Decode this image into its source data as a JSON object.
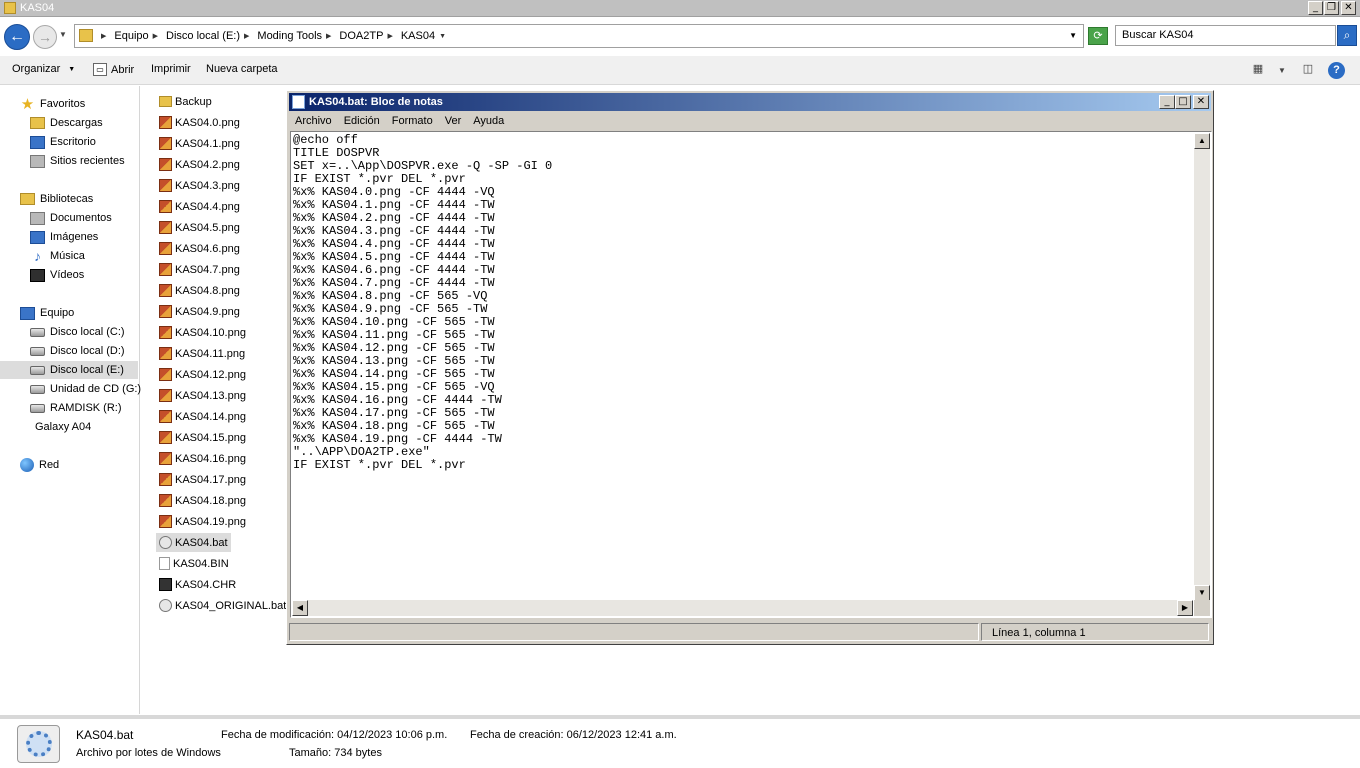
{
  "window": {
    "title": "KAS04"
  },
  "address": {
    "crumbs": [
      "Equipo",
      "Disco local (E:)",
      "Moding Tools",
      "DOA2TP",
      "KAS04"
    ],
    "search_placeholder": "Buscar KAS04"
  },
  "toolbar": {
    "organize": "Organizar",
    "open": "Abrir",
    "print": "Imprimir",
    "new_folder": "Nueva carpeta"
  },
  "nav": {
    "favorites": "Favoritos",
    "downloads": "Descargas",
    "desktop": "Escritorio",
    "recent": "Sitios recientes",
    "libraries": "Bibliotecas",
    "documents": "Documentos",
    "images": "Imágenes",
    "music": "Música",
    "videos": "Vídeos",
    "computer": "Equipo",
    "drive_c": "Disco local (C:)",
    "drive_d": "Disco local (D:)",
    "drive_e": "Disco local (E:)",
    "drive_g": "Unidad de CD (G:)",
    "ramdisk": "RAMDISK (R:)",
    "galaxy": "Galaxy A04",
    "network": "Red"
  },
  "files": [
    {
      "name": "Backup",
      "type": "folder"
    },
    {
      "name": "KAS04.0.png",
      "type": "png"
    },
    {
      "name": "KAS04.1.png",
      "type": "png"
    },
    {
      "name": "KAS04.2.png",
      "type": "png"
    },
    {
      "name": "KAS04.3.png",
      "type": "png"
    },
    {
      "name": "KAS04.4.png",
      "type": "png"
    },
    {
      "name": "KAS04.5.png",
      "type": "png"
    },
    {
      "name": "KAS04.6.png",
      "type": "png"
    },
    {
      "name": "KAS04.7.png",
      "type": "png"
    },
    {
      "name": "KAS04.8.png",
      "type": "png"
    },
    {
      "name": "KAS04.9.png",
      "type": "png"
    },
    {
      "name": "KAS04.10.png",
      "type": "png"
    },
    {
      "name": "KAS04.11.png",
      "type": "png"
    },
    {
      "name": "KAS04.12.png",
      "type": "png"
    },
    {
      "name": "KAS04.13.png",
      "type": "png"
    },
    {
      "name": "KAS04.14.png",
      "type": "png"
    },
    {
      "name": "KAS04.15.png",
      "type": "png"
    },
    {
      "name": "KAS04.16.png",
      "type": "png"
    },
    {
      "name": "KAS04.17.png",
      "type": "png"
    },
    {
      "name": "KAS04.18.png",
      "type": "png"
    },
    {
      "name": "KAS04.19.png",
      "type": "png"
    },
    {
      "name": "KAS04.bat",
      "type": "bat"
    },
    {
      "name": "KAS04.BIN",
      "type": "bin"
    },
    {
      "name": "KAS04.CHR",
      "type": "chr"
    },
    {
      "name": "KAS04_ORIGINAL.bat",
      "type": "bat"
    }
  ],
  "notepad": {
    "title": "KAS04.bat: Bloc de notas",
    "menu": [
      "Archivo",
      "Edición",
      "Formato",
      "Ver",
      "Ayuda"
    ],
    "content": "@echo off\nTITLE DOSPVR\nSET x=..\\App\\DOSPVR.exe -Q -SP -GI 0\nIF EXIST *.pvr DEL *.pvr\n%x% KAS04.0.png -CF 4444 -VQ\n%x% KAS04.1.png -CF 4444 -TW\n%x% KAS04.2.png -CF 4444 -TW\n%x% KAS04.3.png -CF 4444 -TW\n%x% KAS04.4.png -CF 4444 -TW\n%x% KAS04.5.png -CF 4444 -TW\n%x% KAS04.6.png -CF 4444 -TW\n%x% KAS04.7.png -CF 4444 -TW\n%x% KAS04.8.png -CF 565 -VQ\n%x% KAS04.9.png -CF 565 -TW\n%x% KAS04.10.png -CF 565 -TW\n%x% KAS04.11.png -CF 565 -TW\n%x% KAS04.12.png -CF 565 -TW\n%x% KAS04.13.png -CF 565 -TW\n%x% KAS04.14.png -CF 565 -TW\n%x% KAS04.15.png -CF 565 -VQ\n%x% KAS04.16.png -CF 4444 -TW\n%x% KAS04.17.png -CF 565 -TW\n%x% KAS04.18.png -CF 565 -TW\n%x% KAS04.19.png -CF 4444 -TW\n\"..\\APP\\DOA2TP.exe\"\nIF EXIST *.pvr DEL *.pvr",
    "status": "Línea 1, columna 1"
  },
  "details": {
    "name": "KAS04.bat",
    "type": "Archivo por lotes de Windows",
    "modified": "Fecha de modificación: 04/12/2023 10:06 p.m.",
    "created": "Fecha de creación: 06/12/2023 12:41 a.m.",
    "size": "Tamaño: 734 bytes"
  }
}
